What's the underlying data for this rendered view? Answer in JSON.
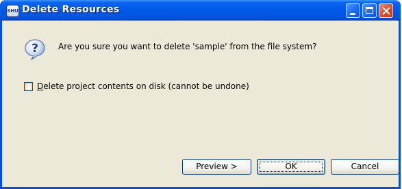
{
  "window": {
    "title": "Delete Resources",
    "app_icon_text": "SHU"
  },
  "dialog": {
    "message": "Are you sure you want to delete 'sample' from the file system?",
    "checkbox": {
      "checked": false,
      "label_accel": "D",
      "label_rest": "elete project contents on disk (cannot be undone)"
    }
  },
  "buttons": {
    "preview_label": "Preview >",
    "ok_label": "OK",
    "cancel_label": "Cancel"
  },
  "icons": {
    "question": "question-icon",
    "minimize": "minimize-icon",
    "maximize": "maximize-icon",
    "close": "close-icon"
  }
}
